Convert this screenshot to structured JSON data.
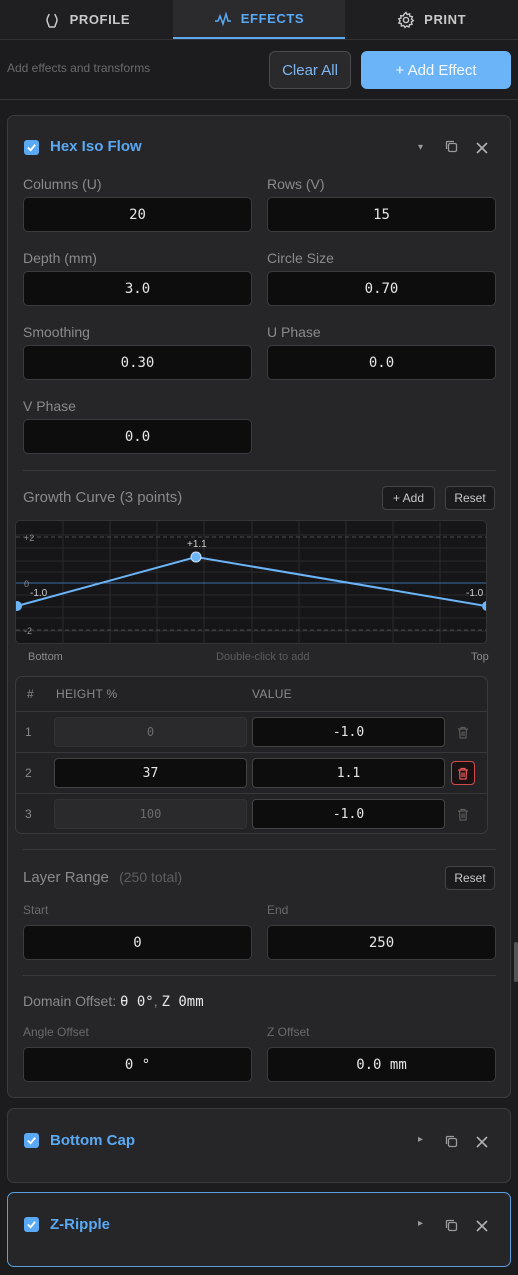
{
  "tabs": [
    {
      "label": "PROFILE",
      "icon": "profile-icon"
    },
    {
      "label": "EFFECTS",
      "icon": "effects-icon"
    },
    {
      "label": "PRINT",
      "icon": "gear-icon"
    }
  ],
  "active_tab": "EFFECTS",
  "toolbar": {
    "hint": "Add effects and transforms",
    "clear_label": "Clear All",
    "add_label": "+ Add Effect"
  },
  "hex_effect": {
    "title": "Hex Iso Flow",
    "enabled": true,
    "fields": {
      "columns_label": "Columns (U)",
      "columns": "20",
      "rows_label": "Rows (V)",
      "rows": "15",
      "depth_label": "Depth (mm)",
      "depth": "3.0",
      "circle_label": "Circle Size",
      "circle": "0.70",
      "smoothing_label": "Smoothing",
      "smoothing": "0.30",
      "uphase_label": "U Phase",
      "uphase": "0.0",
      "vphase_label": "V Phase",
      "vphase": "0.0"
    },
    "growth": {
      "title": "Growth Curve",
      "count": "(3 points)",
      "add_label": "+ Add",
      "reset_label": "Reset",
      "bottom_label": "Bottom",
      "hint": "Double-click to add",
      "top_label": "Top",
      "axis_labels": [
        "+2",
        "0",
        "-2"
      ],
      "point_labels": [
        "-1.0",
        "+1.1",
        "-1.0"
      ],
      "line_color": "#6cb4f8"
    },
    "points_table": {
      "col_num": "#",
      "col_height": "HEIGHT %",
      "col_value": "VALUE",
      "rows": [
        {
          "num": "1",
          "height": "0",
          "value": "-1.0",
          "editable": false
        },
        {
          "num": "2",
          "height": "37",
          "value": "1.1",
          "editable": true
        },
        {
          "num": "3",
          "height": "100",
          "value": "-1.0",
          "editable": false
        }
      ]
    },
    "layer_range": {
      "title": "Layer Range",
      "total": "(250 total)",
      "reset_label": "Reset",
      "start_label": "Start",
      "start": "0",
      "end_label": "End",
      "end": "250"
    },
    "domain_offset": {
      "title": "Domain Offset:",
      "summary_theta": "θ 0°",
      "summary_sep": ",",
      "summary_z": "Z 0mm",
      "angle_label": "Angle Offset",
      "angle": "0 °",
      "z_label": "Z Offset",
      "z": "0.0 mm"
    }
  },
  "bottom_cap": {
    "title": "Bottom Cap",
    "enabled": true
  },
  "z_ripple": {
    "title": "Z-Ripple",
    "enabled": true
  },
  "colors": {
    "accent": "#5aa9f5",
    "danger": "#d04a4a",
    "background": "#1c1c1e"
  }
}
